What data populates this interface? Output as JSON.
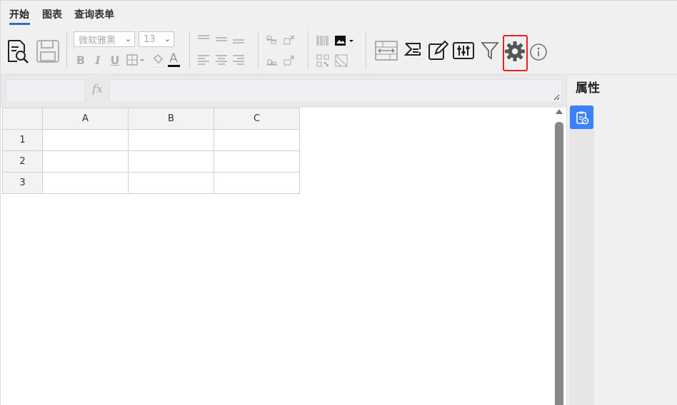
{
  "tabs": [
    {
      "label": "开始"
    },
    {
      "label": "图表"
    },
    {
      "label": "查询表单"
    }
  ],
  "toolbar": {
    "font_family": "微软雅黑",
    "font_size": "13",
    "bold_label": "B",
    "italic_label": "I",
    "underline_label": "U",
    "font_color_label": "A"
  },
  "formula_bar": {
    "fx_label": "fx",
    "name_value": "",
    "formula_value": ""
  },
  "grid": {
    "columns": [
      "A",
      "B",
      "C"
    ],
    "rows": [
      "1",
      "2",
      "3"
    ]
  },
  "panel": {
    "title": "属性"
  },
  "colors": {
    "accent": "#3b82f6",
    "highlight": "#e8201f"
  }
}
